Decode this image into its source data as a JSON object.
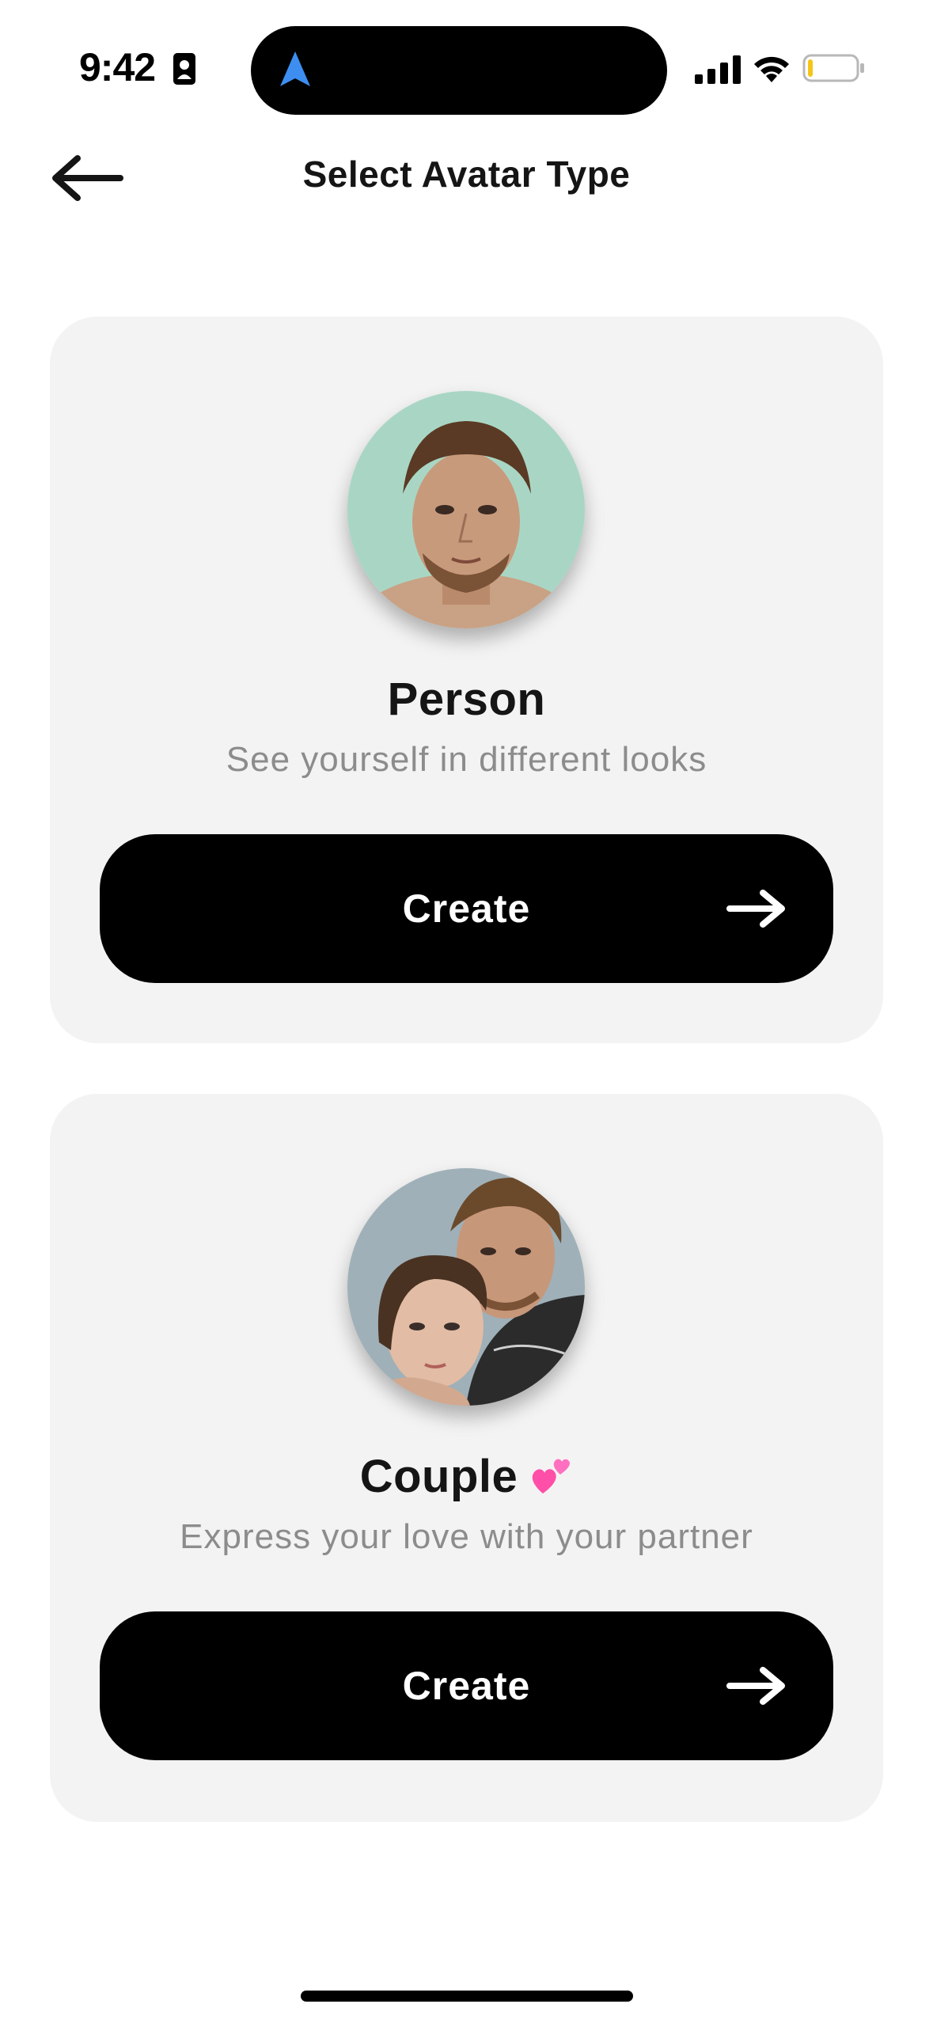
{
  "status_bar": {
    "time": "9:42",
    "icons": [
      "contact-card-icon",
      "location-arrow-icon",
      "cellular-signal-icon",
      "wifi-icon",
      "battery-low-icon"
    ]
  },
  "header": {
    "title": "Select Avatar Type",
    "back_icon": "arrow-left-icon"
  },
  "cards": [
    {
      "title": "Person",
      "subtitle": "See yourself in different looks",
      "button_label": "Create",
      "button_icon": "arrow-right-icon"
    },
    {
      "title": "Couple",
      "title_emoji": "two-hearts-emoji",
      "subtitle": "Express your love with your partner",
      "button_label": "Create",
      "button_icon": "arrow-right-icon"
    }
  ],
  "colors": {
    "card_background": "#f3f3f3",
    "button_background": "#000000",
    "subtitle_text": "#8c8c8c",
    "location_accent": "#3d8ef0",
    "battery_low": "#f5c518",
    "heart_pink": "#ff4fa8"
  }
}
